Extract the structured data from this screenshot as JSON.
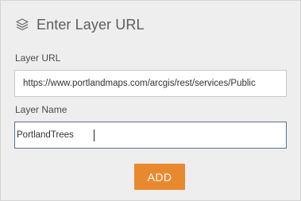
{
  "dialog": {
    "title": "Enter Layer URL",
    "title_icon": "layers-icon",
    "layer_url": {
      "label": "Layer URL",
      "value": "https://www.portlandmaps.com/arcgis/rest/services/Public"
    },
    "layer_name": {
      "label": "Layer Name",
      "value": "PortlandTrees"
    },
    "add_button": {
      "label": "ADD",
      "color": "#e9892f"
    }
  },
  "colors": {
    "panel_bg": "#eeeeee",
    "active_border": "#5a6f8c"
  }
}
